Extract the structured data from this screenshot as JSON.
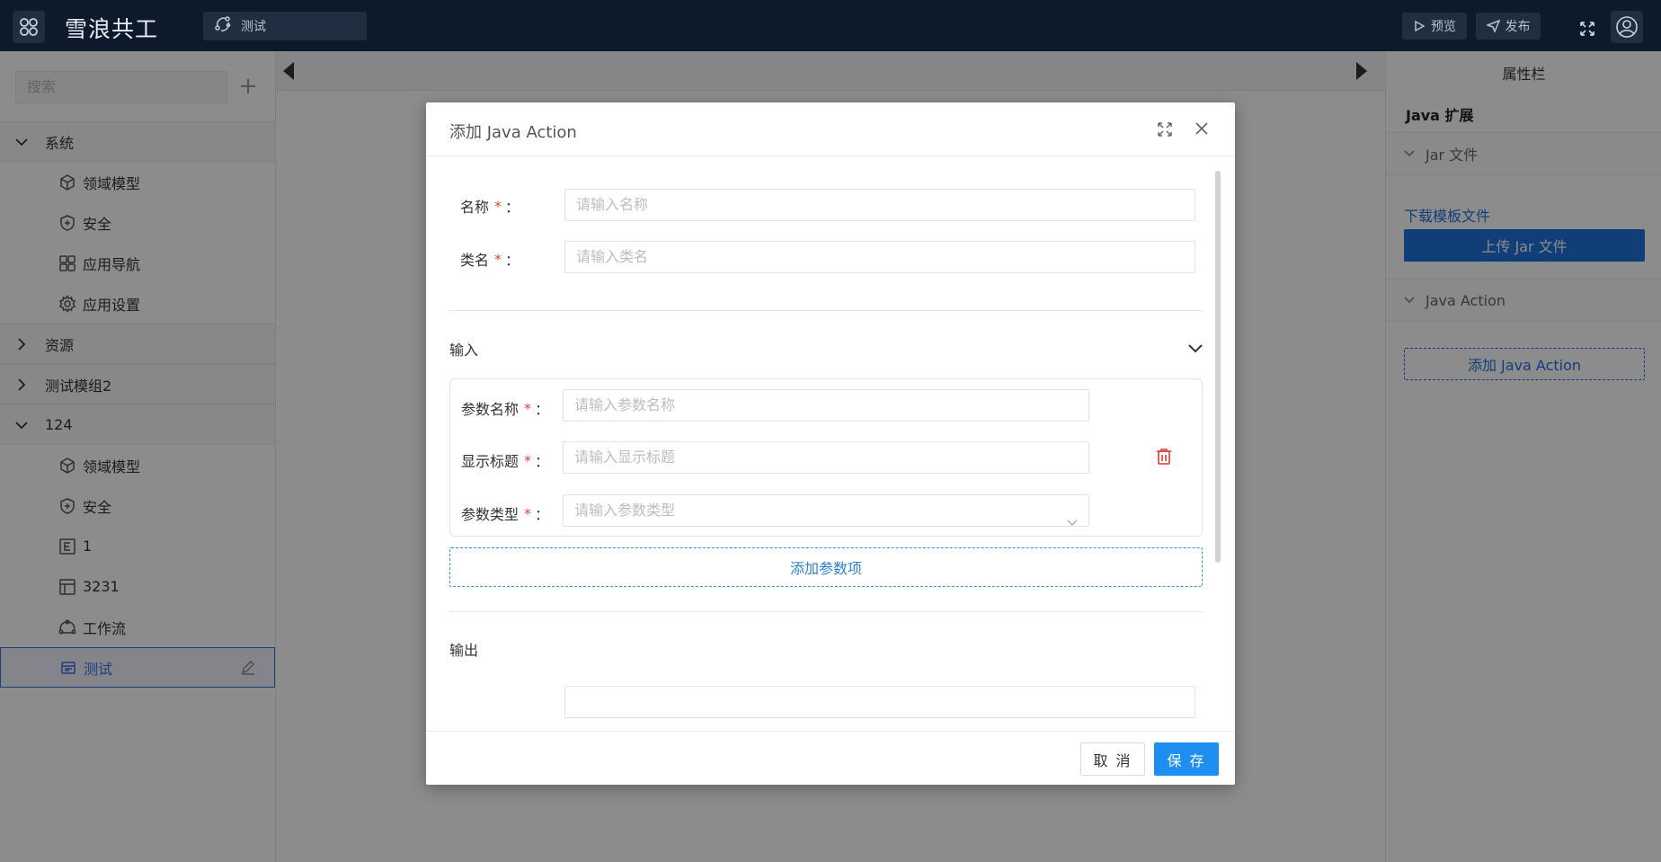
{
  "topbar": {
    "app_title": "雪浪共工",
    "page_name": "测试",
    "preview_label": "预览",
    "publish_label": "发布"
  },
  "sidebar": {
    "search_placeholder": "搜索",
    "groups": [
      {
        "label": "系统",
        "expanded": true,
        "items": [
          {
            "label": "领域模型",
            "icon": "cube-icon"
          },
          {
            "label": "安全",
            "icon": "shield-icon"
          },
          {
            "label": "应用导航",
            "icon": "grid-icon"
          },
          {
            "label": "应用设置",
            "icon": "gear-icon"
          }
        ]
      },
      {
        "label": "资源",
        "expanded": false
      },
      {
        "label": "测试模组2",
        "expanded": false
      },
      {
        "label": "124",
        "expanded": true,
        "items": [
          {
            "label": "领域模型",
            "icon": "cube-icon"
          },
          {
            "label": "安全",
            "icon": "shield-icon"
          },
          {
            "label": "1",
            "icon": "entity-e-icon"
          },
          {
            "label": "3231",
            "icon": "table-icon"
          },
          {
            "label": "工作流",
            "icon": "workflow-icon"
          },
          {
            "label": "测试",
            "icon": "page-icon",
            "active": true
          }
        ]
      }
    ]
  },
  "right_panel": {
    "title": "属性栏",
    "subtitle": "Java 扩展",
    "jar_section": "Jar 文件",
    "download_link": "下载模板文件",
    "upload_button": "上传 Jar 文件",
    "action_section": "Java Action",
    "add_action_button": "添加 Java Action"
  },
  "modal": {
    "title": "添加 Java Action",
    "fields": {
      "name_label": "名称",
      "name_placeholder": "请输入名称",
      "class_label": "类名",
      "class_placeholder": "请输入类名"
    },
    "input_section": {
      "title": "输入",
      "param_name_label": "参数名称",
      "param_name_placeholder": "请输入参数名称",
      "display_title_label": "显示标题",
      "display_title_placeholder": "请输入显示标题",
      "param_type_label": "参数类型",
      "param_type_placeholder": "请输入参数类型",
      "add_param_button": "添加参数项"
    },
    "output_section": {
      "title": "输出"
    },
    "cancel_button": "取 消",
    "save_button": "保 存",
    "required_mark": "*",
    "colon": "："
  },
  "colors": {
    "topbar_bg": "#0c1a2b",
    "primary": "#1f8ef1",
    "link": "#1f6fdc",
    "required": "#ee3c3c",
    "trash": "#e03a3a",
    "active_item": "#3a6ee8"
  }
}
